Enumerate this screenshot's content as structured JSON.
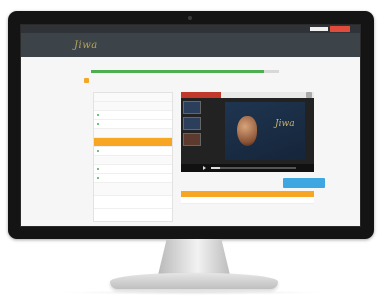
{
  "topbar": {
    "field_text": "",
    "button_text": ""
  },
  "logo_text": "Jiwa",
  "nav": {
    "items": [
      "",
      "",
      "",
      "",
      "",
      ""
    ]
  },
  "course": {
    "title": "",
    "progress_fraction": 0.92,
    "breadcrumb": ""
  },
  "sidebar": {
    "items": [
      {
        "label": "",
        "kind": "head"
      },
      {
        "label": "",
        "kind": "head"
      },
      {
        "label": "",
        "kind": "item"
      },
      {
        "label": "",
        "kind": "item"
      },
      {
        "label": "",
        "kind": "head"
      },
      {
        "label": "",
        "kind": "active"
      },
      {
        "label": "",
        "kind": "item"
      },
      {
        "label": "",
        "kind": "head"
      },
      {
        "label": "",
        "kind": "item"
      },
      {
        "label": "",
        "kind": "item"
      },
      {
        "label": "",
        "kind": "head"
      },
      {
        "label": "",
        "kind": "item"
      }
    ]
  },
  "video": {
    "slide_title": "",
    "slide_logo": "Jiwa",
    "played_fraction": 0.1
  },
  "next_button": "",
  "table": {
    "headers": [
      "",
      ""
    ],
    "rows": [
      [
        "",
        ""
      ]
    ]
  },
  "colors": {
    "accent": "#f6a623",
    "progress": "#4caf50",
    "button": "#3ea6e0",
    "nav_bg": "#3c4349"
  }
}
